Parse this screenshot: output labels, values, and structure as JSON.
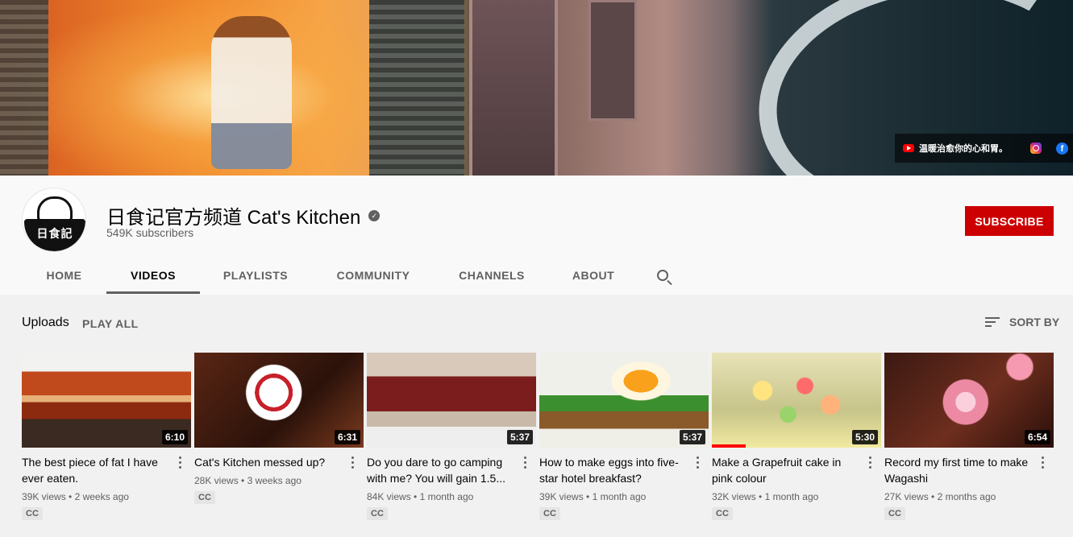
{
  "banner": {
    "social_text": "温暖治愈你的心和胃。",
    "icons": [
      "youtube-icon",
      "instagram-icon",
      "facebook-icon"
    ]
  },
  "channel": {
    "avatar_text": "日食記",
    "name": "日食记官方频道 Cat's Kitchen",
    "verified_glyph": "✓",
    "subscribers": "549K subscribers",
    "subscribe_label": "SUBSCRIBE",
    "subscribe_color": "#cc0000"
  },
  "tabs": [
    {
      "label": "HOME",
      "active": false
    },
    {
      "label": "VIDEOS",
      "active": true
    },
    {
      "label": "PLAYLISTS",
      "active": false
    },
    {
      "label": "COMMUNITY",
      "active": false
    },
    {
      "label": "CHANNELS",
      "active": false
    },
    {
      "label": "ABOUT",
      "active": false
    }
  ],
  "uploads": {
    "label": "Uploads",
    "play_all": "PLAY ALL",
    "sort_by": "SORT BY"
  },
  "videos": [
    {
      "title": "The best piece of fat I have ever eaten.",
      "duration": "6:10",
      "views": "39K views",
      "age": "2 weeks ago",
      "badge": "CC"
    },
    {
      "title": "Cat's Kitchen messed up?",
      "duration": "6:31",
      "views": "28K views",
      "age": "3 weeks ago",
      "badge": "CC"
    },
    {
      "title": "Do you dare to go camping with me? You will gain 1.5...",
      "duration": "5:37",
      "views": "84K views",
      "age": "1 month ago",
      "badge": "CC"
    },
    {
      "title": "How to make eggs into five-star hotel breakfast?",
      "duration": "5:37",
      "views": "39K views",
      "age": "1 month ago",
      "badge": "CC"
    },
    {
      "title": "Make a Grapefruit cake in pink colour",
      "duration": "5:30",
      "views": "32K views",
      "age": "1 month ago",
      "badge": "CC",
      "watched": true
    },
    {
      "title": "Record my first time to make Wagashi",
      "duration": "6:54",
      "views": "27K views",
      "age": "2 months ago",
      "badge": "CC"
    }
  ],
  "colors": {
    "accent_red": "#cc0000",
    "progress_red": "#ff0000",
    "text_secondary": "#606060"
  }
}
